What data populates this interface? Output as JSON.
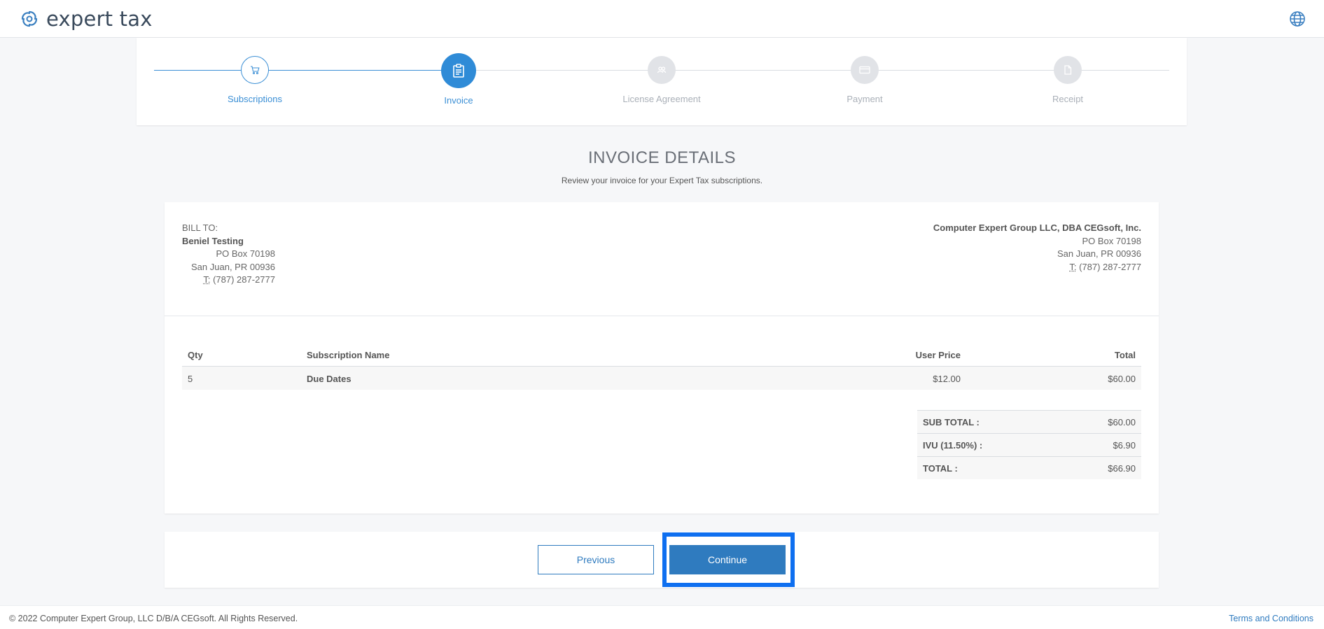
{
  "header": {
    "brand": "expert tax",
    "logo_icon": "swirl-logo-icon",
    "language_icon": "globe-icon"
  },
  "stepper": {
    "steps": [
      {
        "label": "Subscriptions",
        "icon": "cart-icon",
        "state": "done"
      },
      {
        "label": "Invoice",
        "icon": "clipboard-icon",
        "state": "active"
      },
      {
        "label": "License Agreement",
        "icon": "users-icon",
        "state": "pending"
      },
      {
        "label": "Payment",
        "icon": "credit-card-icon",
        "state": "pending"
      },
      {
        "label": "Receipt",
        "icon": "document-icon",
        "state": "pending"
      }
    ]
  },
  "page": {
    "title": "INVOICE DETAILS",
    "subtitle": "Review your invoice for your Expert Tax subscriptions."
  },
  "bill_to": {
    "heading": "BILL TO:",
    "name": "Beniel Testing",
    "address1": "PO Box 70198",
    "address2": "San Juan, PR 00936",
    "phone_label": "T:",
    "phone": "(787) 287-2777"
  },
  "company": {
    "name": "Computer Expert Group LLC, DBA CEGsoft, Inc.",
    "address1": "PO Box 70198",
    "address2": "San Juan, PR 00936",
    "phone_label": "T:",
    "phone": "(787) 287-2777"
  },
  "items_table": {
    "headers": {
      "qty": "Qty",
      "name": "Subscription Name",
      "price": "User Price",
      "total": "Total"
    },
    "rows": [
      {
        "qty": "5",
        "name": "Due Dates",
        "price": "$12.00",
        "total": "$60.00"
      }
    ]
  },
  "totals": {
    "subtotal_label": "SUB TOTAL :",
    "subtotal": "$60.00",
    "tax_label": "IVU (11.50%) :",
    "tax": "$6.90",
    "total_label": "TOTAL :",
    "total": "$66.90"
  },
  "actions": {
    "previous_label": "Previous",
    "continue_label": "Continue"
  },
  "footer": {
    "copyright": "© 2022 Computer Expert Group, LLC D/B/A CEGsoft. All Rights Reserved.",
    "terms_label": "Terms and Conditions"
  },
  "colors": {
    "accent": "#2f7bbf",
    "step_active": "#2f8bd7",
    "focus_ring": "#0e6ff0"
  }
}
